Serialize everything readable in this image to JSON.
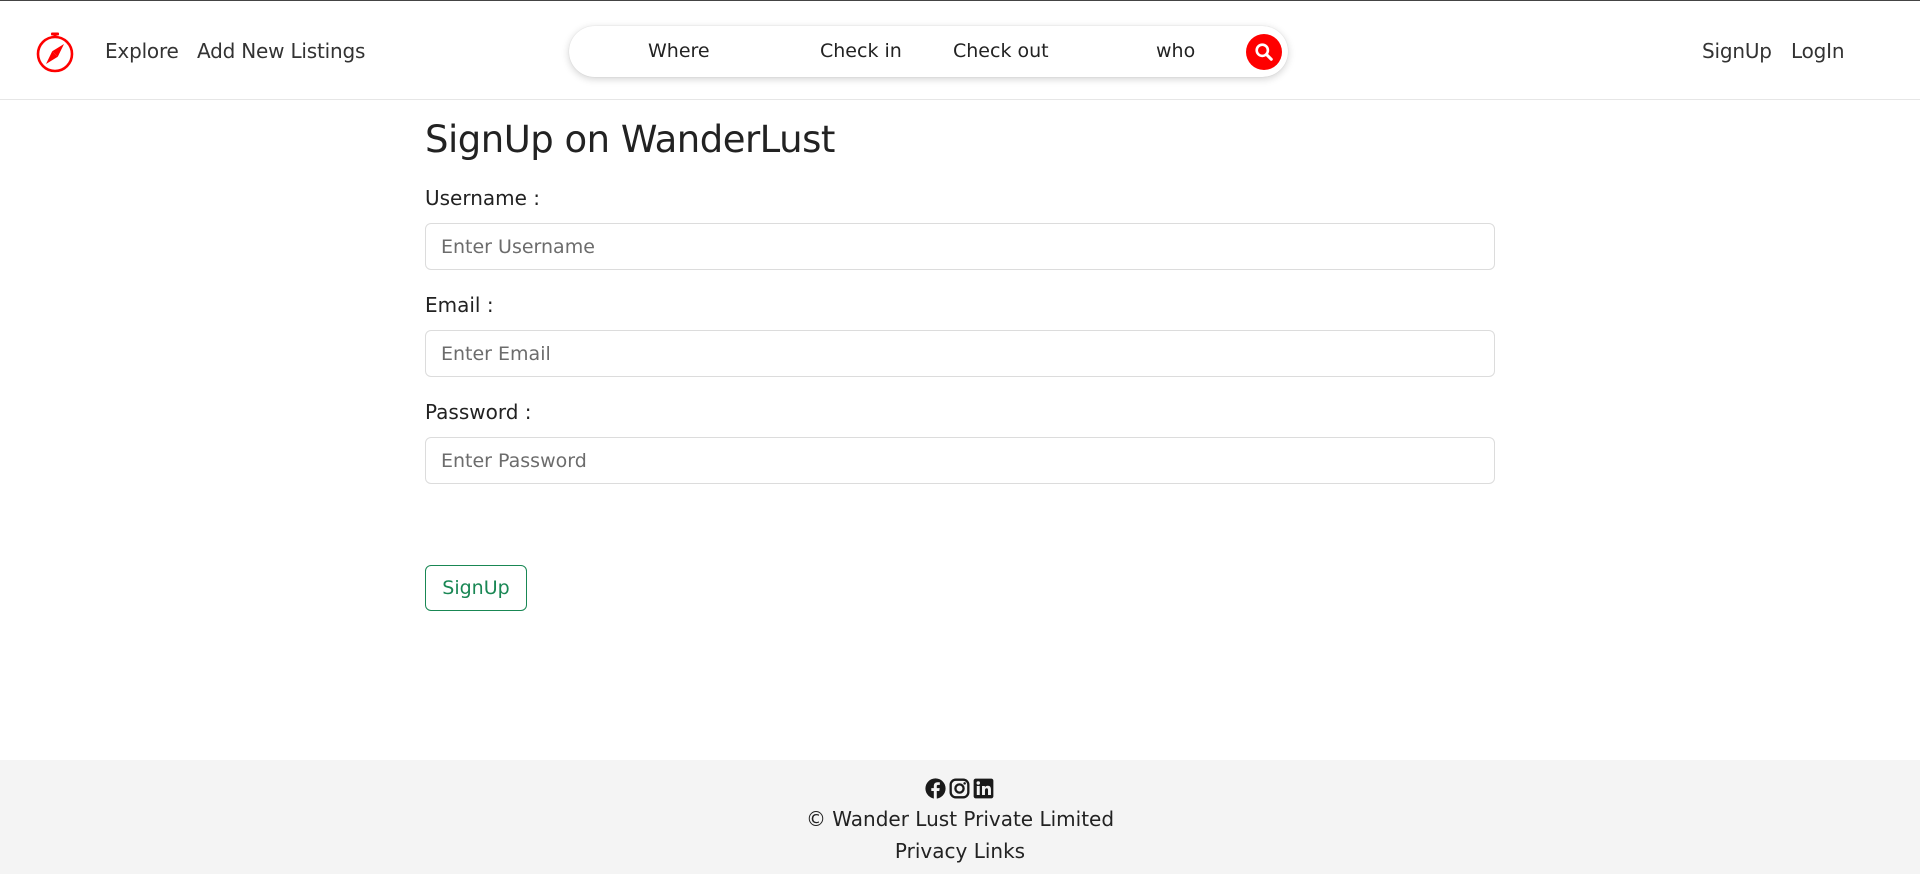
{
  "navbar": {
    "brand_icon": "compass-icon",
    "links": {
      "explore": "Explore",
      "add_listing": "Add New Listings",
      "signup": "SignUp",
      "login": "LogIn"
    },
    "search": {
      "where": "Where",
      "check_in": "Check in",
      "check_out": "Check out",
      "who": "who",
      "button_icon": "search-icon"
    }
  },
  "form": {
    "title": "SignUp on WanderLust",
    "username_label": "Username :",
    "username_placeholder": "Enter Username",
    "username_value": "",
    "email_label": "Email :",
    "email_placeholder": "Enter Email",
    "email_value": "",
    "password_label": "Password :",
    "password_placeholder": "Enter Password",
    "password_value": "",
    "submit_label": "SignUp"
  },
  "footer": {
    "socials": [
      "facebook-icon",
      "instagram-icon",
      "linkedin-icon"
    ],
    "copyright": "© Wander Lust Private Limited",
    "privacy": "Privacy Links"
  },
  "colors": {
    "accent": "#fe0000",
    "success": "#198754",
    "footer_bg": "#f4f4f4"
  }
}
